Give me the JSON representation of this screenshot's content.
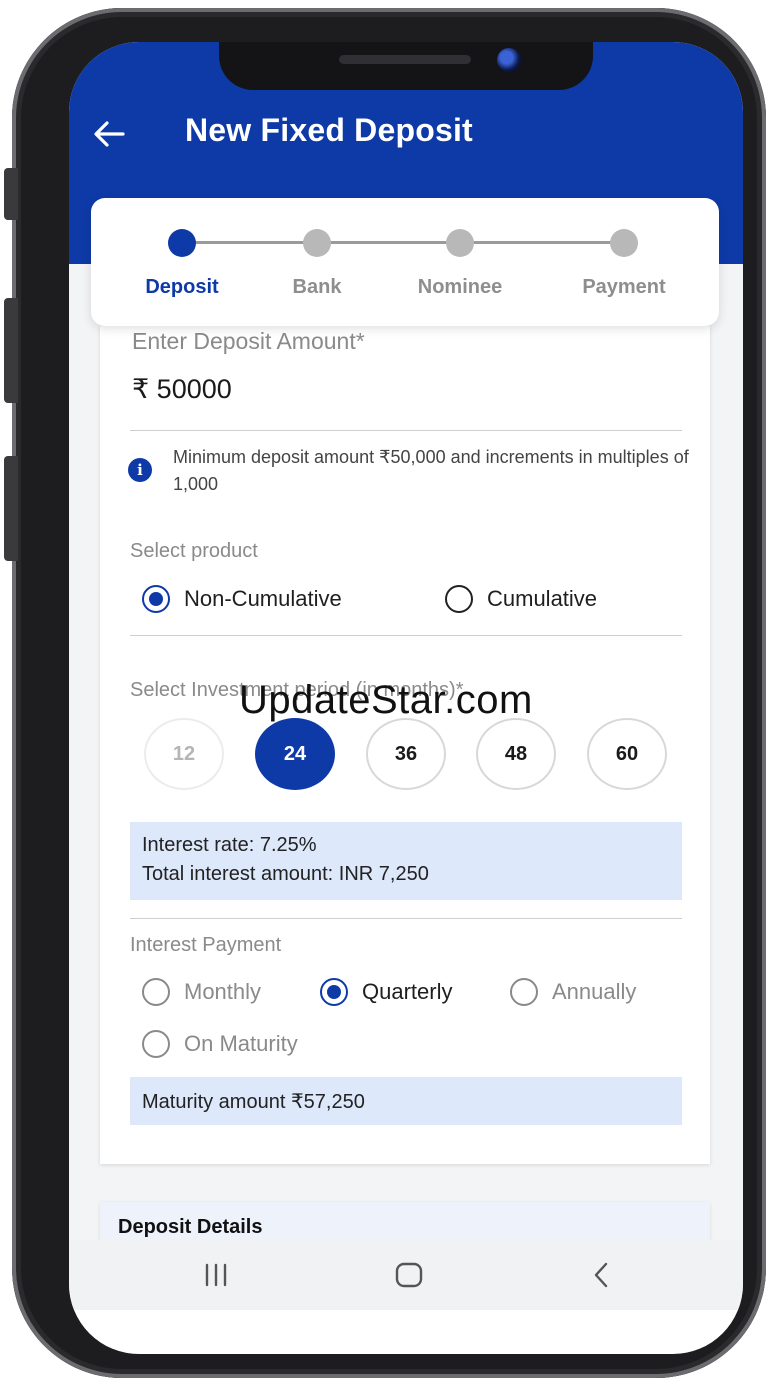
{
  "header": {
    "title": "New Fixed Deposit"
  },
  "stepper": {
    "steps": [
      {
        "label": "Deposit",
        "active": true
      },
      {
        "label": "Bank",
        "active": false
      },
      {
        "label": "Nominee",
        "active": false
      },
      {
        "label": "Payment",
        "active": false
      }
    ]
  },
  "deposit": {
    "label": "Enter Deposit Amount*",
    "amount": "₹ 50000",
    "info": "Minimum deposit amount ₹50,000 and increments in multiples of 1,000"
  },
  "product": {
    "label": "Select product",
    "options": [
      {
        "label": "Non-Cumulative",
        "selected": true
      },
      {
        "label": "Cumulative",
        "selected": false
      }
    ]
  },
  "period": {
    "label": "Select Investment period (in months)*",
    "options": [
      "12",
      "24",
      "36",
      "48",
      "60"
    ],
    "selected": "24"
  },
  "interest": {
    "rate": "Interest rate: 7.25%",
    "total": "Total interest amount: INR 7,250"
  },
  "interest_payment": {
    "label": "Interest Payment",
    "options": [
      {
        "label": "Monthly",
        "selected": false
      },
      {
        "label": "Quarterly",
        "selected": true
      },
      {
        "label": "Annually",
        "selected": false
      },
      {
        "label": "On Maturity",
        "selected": false
      }
    ]
  },
  "maturity": {
    "text": "Maturity amount ₹57,250"
  },
  "details": {
    "title": "Deposit Details"
  },
  "watermark": "UpdateStar.com",
  "colors": {
    "primary": "#0e3aa8",
    "highlight": "#dde8fb"
  }
}
